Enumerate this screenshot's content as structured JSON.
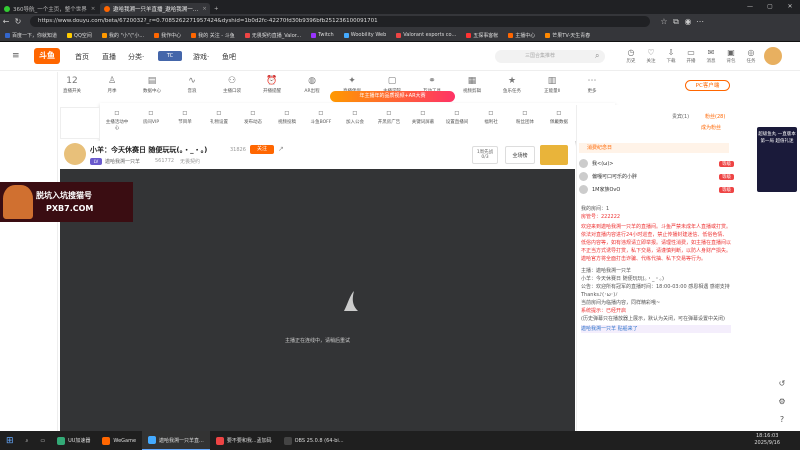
{
  "tabs": [
    {
      "label": "360导航_一个主页，整个世界",
      "color": "#3c3"
    },
    {
      "label": "遨哈我溯一只羊直播_遨哈我溯一…",
      "color": "#f60",
      "active": true
    }
  ],
  "address": {
    "url": "https://www.douyu.com/beta/6720032?_r=0.7085262271957424&dyshid=1b0d2fc-42270fd30b9396bfb251236100091701"
  },
  "bookmarks": [
    {
      "label": "百度一下，你就知道",
      "color": "#36c"
    },
    {
      "label": "QQ空间",
      "color": "#fc0"
    },
    {
      "label": "我的 \"小\"(\"小...",
      "color": "#f90"
    },
    {
      "label": "我作中心",
      "color": "#f60"
    },
    {
      "label": "我的 关注 - 斗鱼",
      "color": "#f60"
    },
    {
      "label": "无畏契约直播_Valor...",
      "color": "#e44"
    },
    {
      "label": "Twitch",
      "color": "#93f"
    },
    {
      "label": "Woobility Web",
      "color": "#4af"
    },
    {
      "label": "Valorant esports co...",
      "color": "#e44"
    },
    {
      "label": "五探事客帐",
      "color": "#f33"
    },
    {
      "label": "主播中心",
      "color": "#f60"
    },
    {
      "label": "芒果TV-天生青春",
      "color": "#f80"
    }
  ],
  "header": {
    "logo": "斗鱼",
    "nav": [
      "首页",
      "直播",
      "分类·",
      "游戏·",
      "鱼吧"
    ],
    "search_placeholder": "三国合集推荐",
    "icons": [
      {
        "label": "历史",
        "glyph": "◷"
      },
      {
        "label": "关注",
        "glyph": "♡"
      },
      {
        "label": "下载",
        "glyph": "⇩"
      },
      {
        "label": "开播",
        "glyph": "▭"
      },
      {
        "label": "消息",
        "glyph": "✉"
      },
      {
        "label": "背包",
        "glyph": "▣"
      },
      {
        "label": "任务",
        "glyph": "◎"
      }
    ]
  },
  "categories": [
    {
      "label": "直播开关",
      "glyph": "12"
    },
    {
      "label": "月季",
      "glyph": "♙"
    },
    {
      "label": "数据中心",
      "glyph": "▤"
    },
    {
      "label": "音浪",
      "glyph": "∿"
    },
    {
      "label": "主播口袋",
      "glyph": "⚇"
    },
    {
      "label": "开播提醒",
      "glyph": "⏰"
    },
    {
      "label": "AR出程",
      "glyph": "◍"
    },
    {
      "label": "直播伴侣",
      "glyph": "✦"
    },
    {
      "label": "主播学院",
      "glyph": "▢"
    },
    {
      "label": "互动工具",
      "glyph": "⚭"
    },
    {
      "label": "视频剪辑",
      "glyph": "▦"
    },
    {
      "label": "鱼乐任务",
      "glyph": "★"
    },
    {
      "label": "正能量Ⅱ",
      "glyph": "▥"
    },
    {
      "label": "更多",
      "glyph": "⋯"
    }
  ],
  "dropdown": [
    "主播活动中心",
    "房间VIP",
    "节目单",
    "礼物设置",
    "发布动态",
    "视频投稿",
    "斗鱼BOFF",
    "加入公会",
    "开黑房广告",
    "关键词屏蔽",
    "设置直播间",
    "福利社",
    "粉丝团体",
    "佩戴数据",
    "发言"
  ],
  "stream": {
    "title": "小羊：今天休赛日 随便玩玩(。・_・。)",
    "streamer": "遨哈我溯一只羊",
    "hot": "561772",
    "tag": "无畏契约",
    "room_id": "31826",
    "follow": "关注",
    "mid_btn": "全场榜",
    "loading_text": "主播正在连线中，请稍后重试",
    "ticket": "1周先战 0/3"
  },
  "side": {
    "tabs": [
      "贵宾(1)",
      "粉丝(28)"
    ],
    "header": "消费纪念日",
    "rank": [
      {
        "name": "我<(ω)>",
        "lvl": "等级"
      },
      {
        "name": "偏嘎可口可乐的小胖",
        "lvl": "等级"
      },
      {
        "name": "1M家族OvO",
        "lvl": "等级"
      }
    ],
    "room_title": "我的房间：1",
    "admin": "房管号：222222",
    "notice": "欢迎来到遨哈我溯一只羊的直播间。斗鱼严禁未成年人直播或打赏。依法对直播内容进行24小时巡查，禁止传播封建迷信、低俗色情、低俗内容等，如有违规请立即举报。请理性消费，如主播在直播间以不正当方式诱导打赏，私下交易，请谨慎判断，以防人身财产损失。遨哈官方将全面打击诈骗、代练代抽、私下交易等行为。",
    "welcome": "主播：遨哈我溯一只羊",
    "msg1": "小羊：今天休赛日 随便玩玩(。・_・。)",
    "msg2": "公告：欢迎所有冠军的直播时间：18:00-03:00 感恩相遇 感谢支持Thanks♪(･ω･)ﾉ",
    "msg3": "当前房间为临播内容，同样精彩哦~",
    "sys": "系统提示：已经开启",
    "sys2": "(历史弹幕只在播放器上展示，默认为关闭，可在弹幕设置中关闭)",
    "bottom": "遨哈我溯一只羊 贴船来了",
    "pc_btn": "PC客户端",
    "promo": "超级鱼丸 一直版本 第一局 超值礼迷"
  },
  "ad": {
    "line1": "脱坑入坑搜猫号",
    "line2": "PXB7.COM"
  },
  "taskbar": {
    "items": [
      "UU加速器",
      "WeGame",
      "遨哈我溯一只羊直...",
      "要不要和我...孟加码",
      "OBS 25.0.8 (64-bi..."
    ],
    "time": "18:16:03",
    "date": "2025/9/16"
  }
}
